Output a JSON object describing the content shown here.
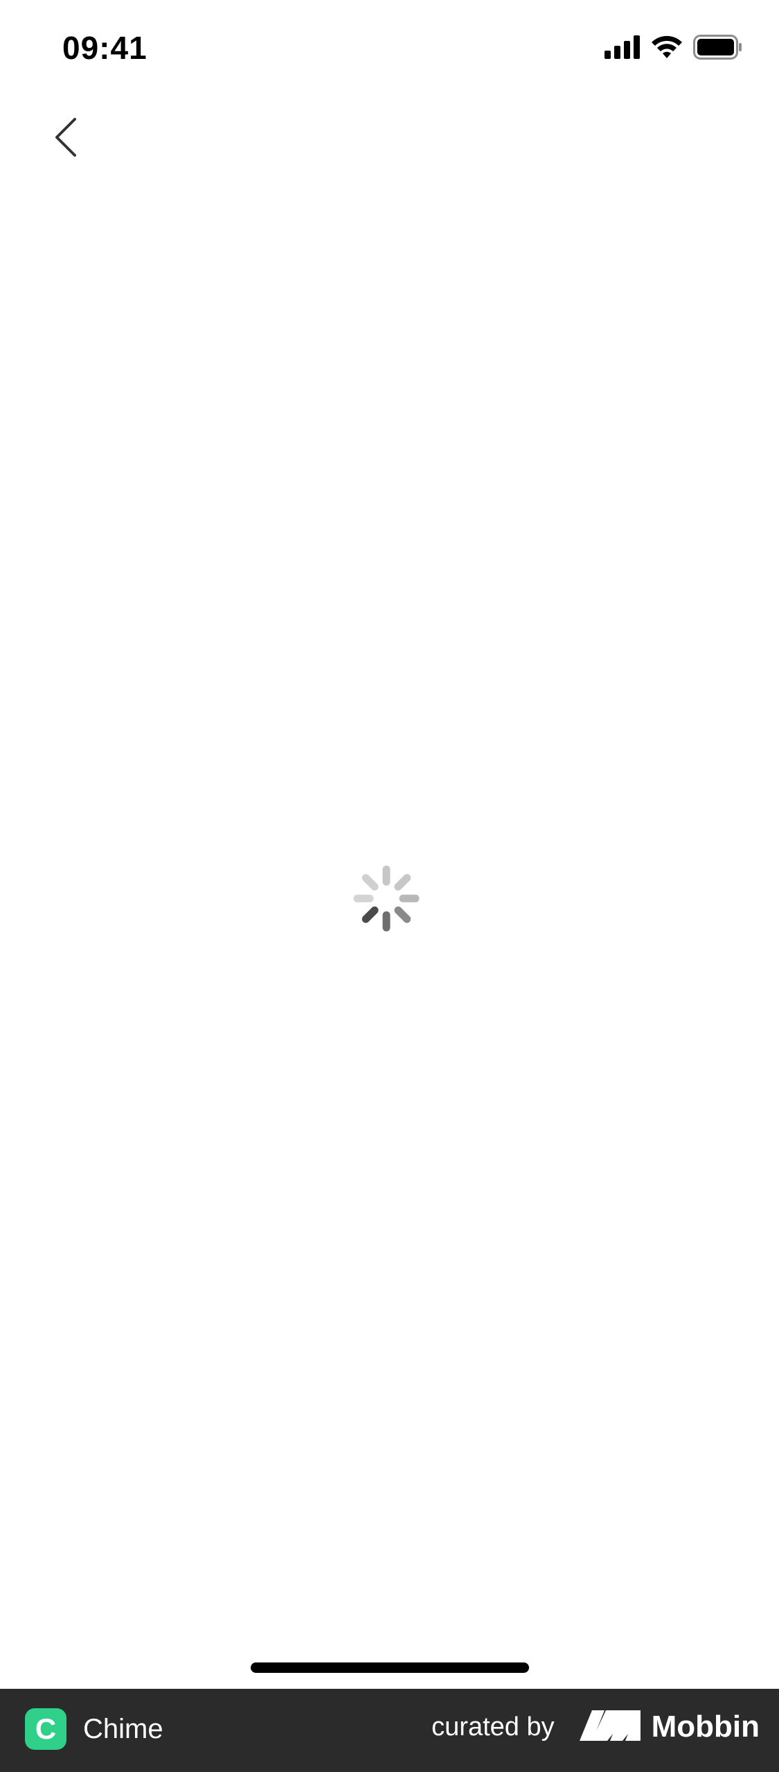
{
  "status_bar": {
    "time": "09:41",
    "icons": [
      "cellular-signal-icon",
      "wifi-icon",
      "battery-icon"
    ]
  },
  "nav": {
    "back_icon": "chevron-left-icon"
  },
  "content": {
    "loading_indicator": "activity-spinner-icon"
  },
  "footer": {
    "app_name": "Chime",
    "app_logo_letter": "C",
    "curated_label": "curated by",
    "brand_name": "Mobbin",
    "colors": {
      "background": "#2b2b2b",
      "app_logo": "#2fd08a"
    }
  }
}
